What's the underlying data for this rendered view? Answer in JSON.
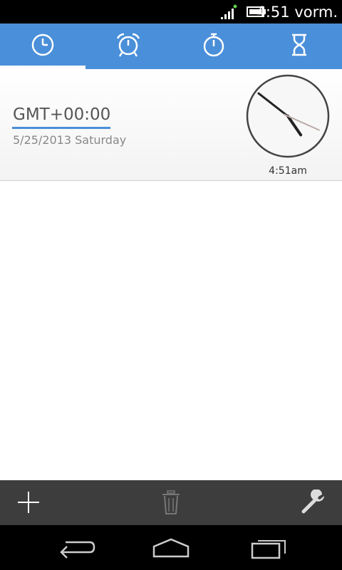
{
  "status_bar": {
    "time": "4:51 vorm.",
    "icons": [
      "signal-icon",
      "battery-icon"
    ]
  },
  "tabs": [
    {
      "name": "tab-world-clock",
      "icon": "clock-icon",
      "selected": true
    },
    {
      "name": "tab-alarm",
      "icon": "alarm-clock-icon",
      "selected": false
    },
    {
      "name": "tab-stopwatch",
      "icon": "stopwatch-icon",
      "selected": false
    },
    {
      "name": "tab-timer",
      "icon": "hourglass-icon",
      "selected": false
    }
  ],
  "clock_entry": {
    "timezone": "GMT+00:00",
    "date": "5/25/2013 Saturday",
    "time_caption": "4:51am",
    "analog_time": {
      "hour": 4,
      "minute": 51,
      "second": 19
    }
  },
  "action_bar": {
    "icons": [
      "add-icon",
      "trash-icon",
      "wrench-icon"
    ]
  },
  "nav_bar": {
    "icons": [
      "back-icon",
      "home-icon",
      "recent-apps-icon"
    ]
  },
  "colors": {
    "accent": "#4a8fd9",
    "action_bar": "#3d3d3d"
  }
}
